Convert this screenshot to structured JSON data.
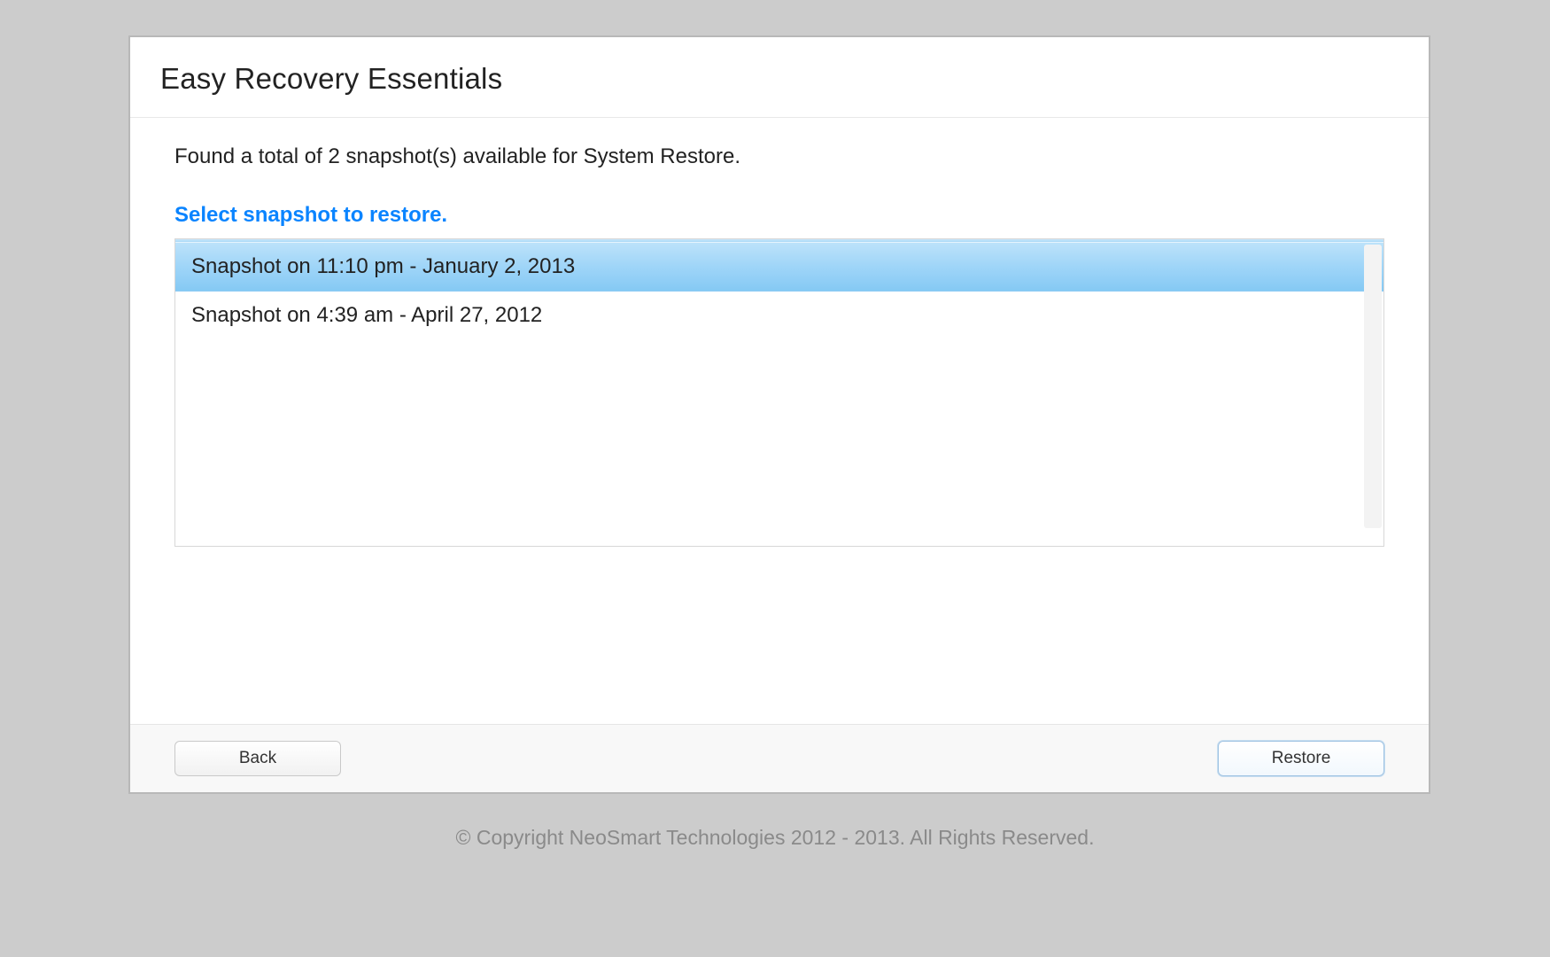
{
  "header": {
    "title": "Easy Recovery Essentials"
  },
  "main": {
    "status_text": "Found a total of 2 snapshot(s) available for System Restore.",
    "instruction_text": "Select snapshot to restore.",
    "snapshots": [
      {
        "label": "Snapshot on 11:10 pm - January 2, 2013",
        "selected": true
      },
      {
        "label": "Snapshot on 4:39 am - April 27, 2012",
        "selected": false
      }
    ]
  },
  "footer": {
    "back_label": "Back",
    "restore_label": "Restore"
  },
  "copyright": "© Copyright NeoSmart Technologies 2012 - 2013. All Rights Reserved."
}
